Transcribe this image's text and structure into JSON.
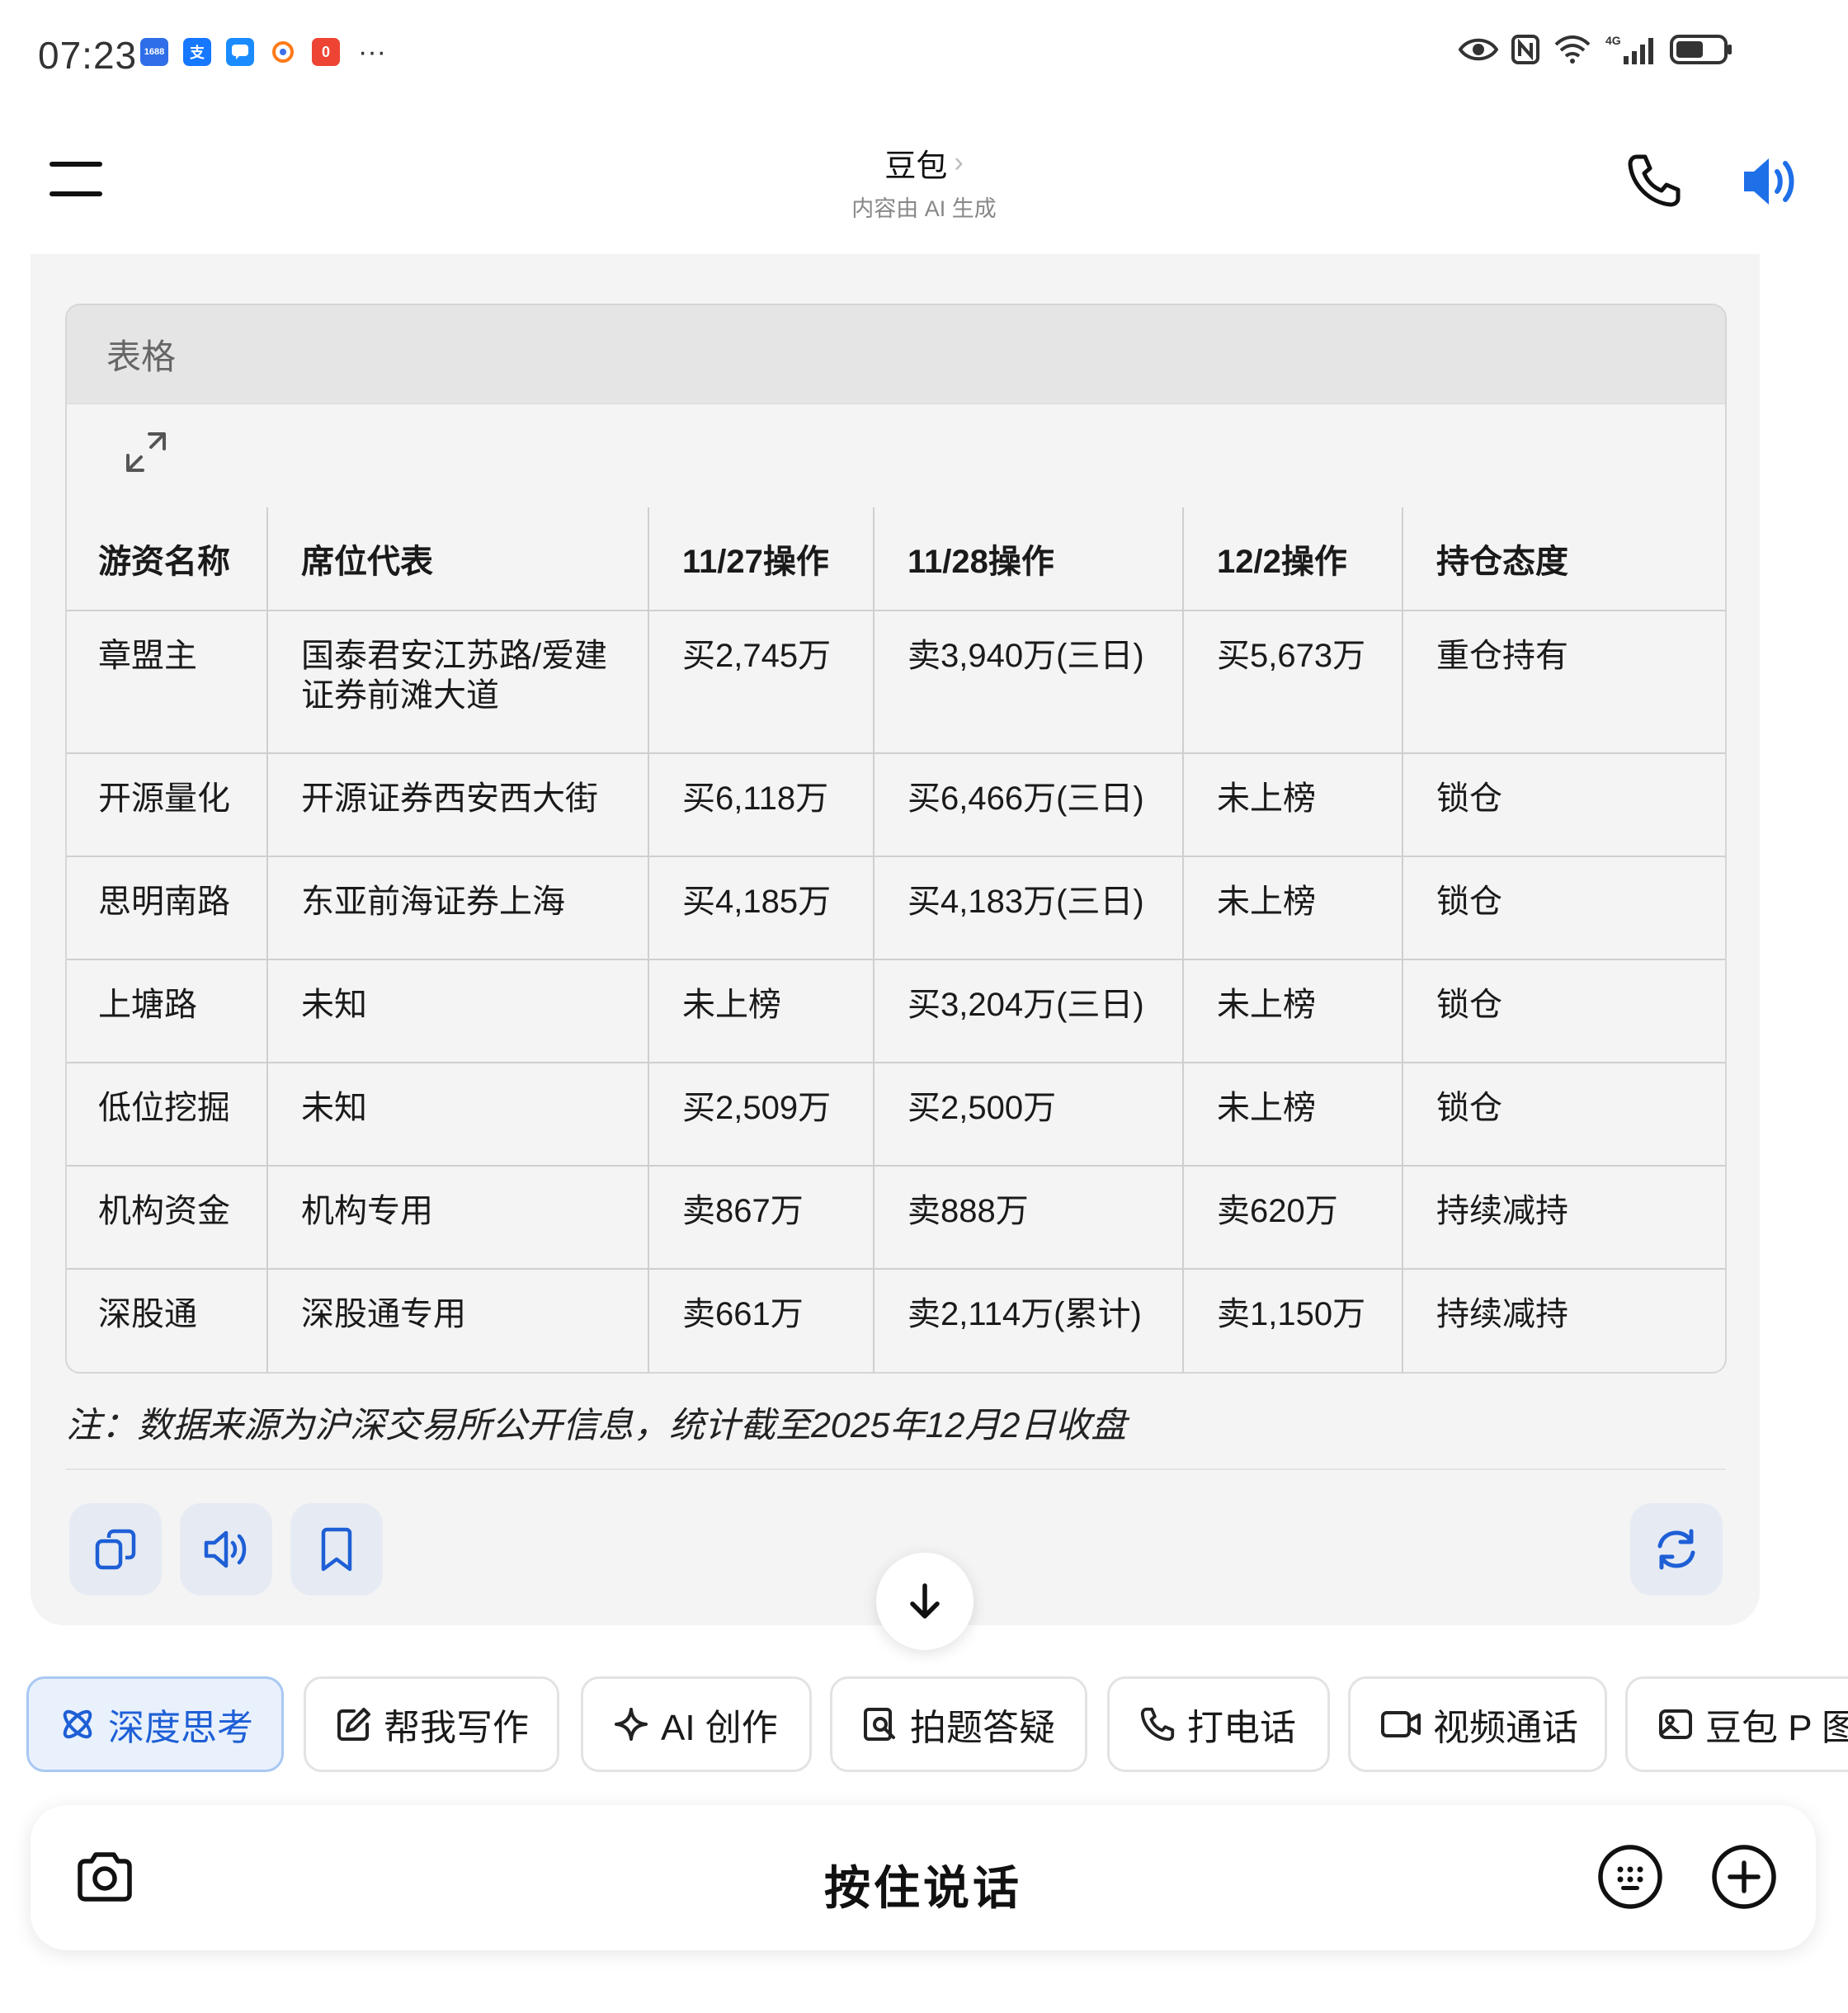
{
  "status_bar": {
    "time": "07:23",
    "apps": [
      {
        "name": "1688",
        "label": "1688",
        "color": "#2f6ee8"
      },
      {
        "name": "alipay",
        "label": "支",
        "color": "#1677ff"
      },
      {
        "name": "message",
        "label": "",
        "color": "#1a8cff"
      },
      {
        "name": "app-orange",
        "label": "",
        "color": "#ff7a1a"
      },
      {
        "name": "app-red",
        "label": "0",
        "color": "#ee4433"
      }
    ],
    "more": "···"
  },
  "header": {
    "title": "豆包",
    "subtitle": "内容由 AI 生成"
  },
  "table": {
    "caption": "表格",
    "headers": [
      "游资名称",
      "席位代表",
      "11/27操作",
      "11/28操作",
      "12/2操作",
      "持仓态度"
    ],
    "rows": [
      [
        "章盟主",
        "国泰君安江苏路/爱建证券前滩大道",
        "买2,745万",
        "卖3,940万(三日)",
        "买5,673万",
        "重仓持有"
      ],
      [
        "开源量化",
        "开源证券西安西大街",
        "买6,118万",
        "买6,466万(三日)",
        "未上榜",
        "锁仓"
      ],
      [
        "思明南路",
        "东亚前海证券上海",
        "买4,185万",
        "买4,183万(三日)",
        "未上榜",
        "锁仓"
      ],
      [
        "上塘路",
        "未知",
        "未上榜",
        "买3,204万(三日)",
        "未上榜",
        "锁仓"
      ],
      [
        "低位挖掘",
        "未知",
        "买2,509万",
        "买2,500万",
        "未上榜",
        "锁仓"
      ],
      [
        "机构资金",
        "机构专用",
        "卖867万",
        "卖888万",
        "卖620万",
        "持续减持"
      ],
      [
        "深股通",
        "深股通专用",
        "卖661万",
        "卖2,114万(累计)",
        "卖1,150万",
        "持续减持"
      ]
    ],
    "note": "注：数据来源为沪深交易所公开信息，统计截至2025年12月2日收盘"
  },
  "chips": [
    {
      "label": "深度思考",
      "icon": "atom-icon",
      "active": true
    },
    {
      "label": "帮我写作",
      "icon": "edit-icon",
      "active": false
    },
    {
      "label": "AI 创作",
      "icon": "sparkle-icon",
      "active": false
    },
    {
      "label": "拍题答疑",
      "icon": "scan-question-icon",
      "active": false
    },
    {
      "label": "打电话",
      "icon": "phone-icon",
      "active": false
    },
    {
      "label": "视频通话",
      "icon": "video-icon",
      "active": false
    },
    {
      "label": "豆包 P 图",
      "icon": "image-edit-icon",
      "active": false
    }
  ],
  "input": {
    "label": "按住说话"
  },
  "colors": {
    "accent": "#1e5fd6",
    "card_bg": "#f4f4f5"
  }
}
